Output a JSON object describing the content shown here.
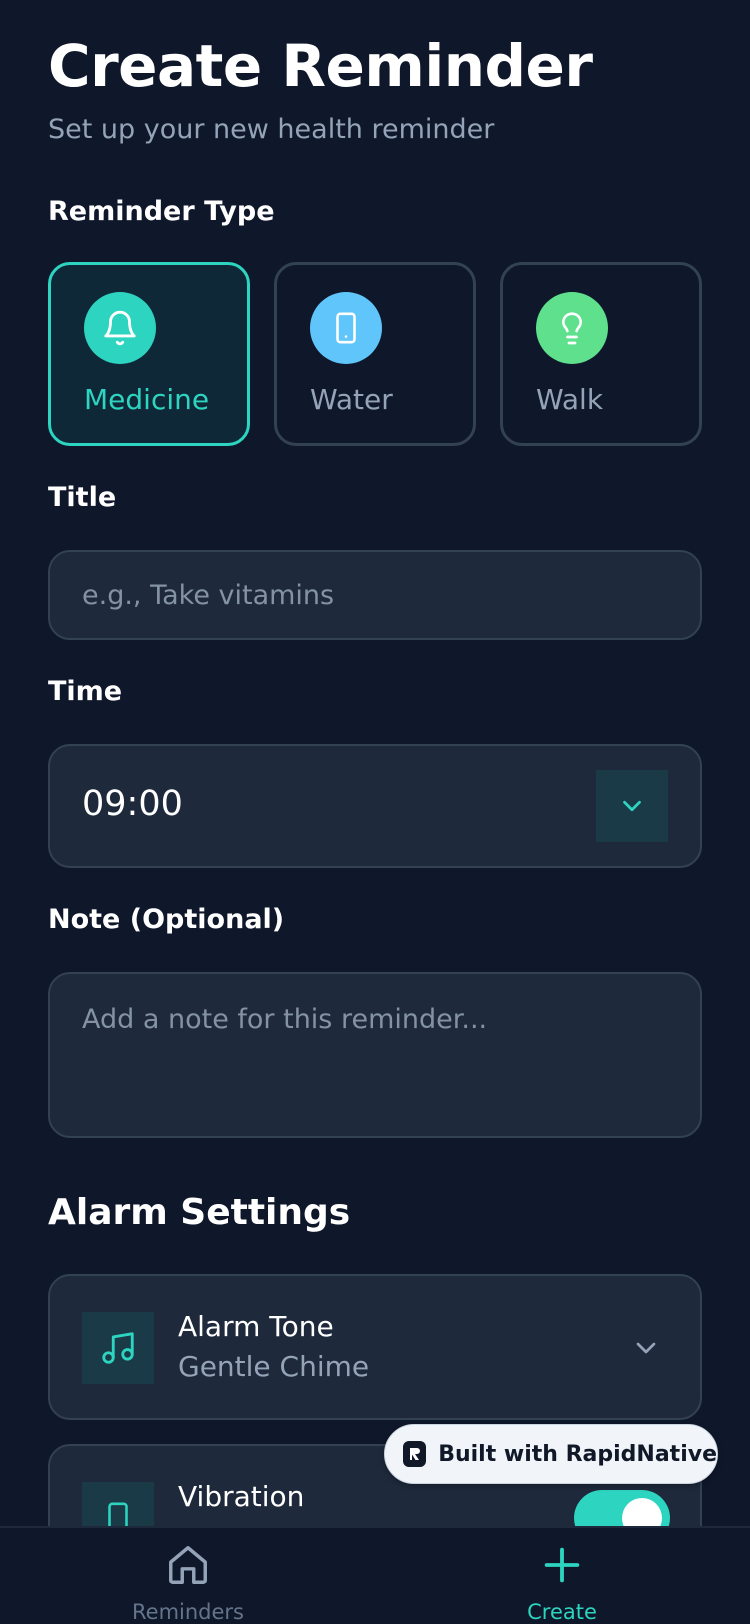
{
  "header": {
    "title": "Create Reminder",
    "subtitle": "Set up your new health reminder"
  },
  "reminder_type": {
    "label": "Reminder Type",
    "options": [
      {
        "label": "Medicine",
        "icon": "bell-icon",
        "color": "#2dd4bf",
        "selected": true
      },
      {
        "label": "Water",
        "icon": "phone-icon",
        "color": "#60c5fa",
        "selected": false
      },
      {
        "label": "Walk",
        "icon": "lightbulb-icon",
        "color": "#5fe08c",
        "selected": false
      }
    ]
  },
  "title_field": {
    "label": "Title",
    "placeholder": "e.g., Take vitamins"
  },
  "time_field": {
    "label": "Time",
    "value": "09:00"
  },
  "note_field": {
    "label": "Note (Optional)",
    "placeholder": "Add a note for this reminder..."
  },
  "alarm_settings": {
    "title": "Alarm Settings",
    "alarm_tone": {
      "title": "Alarm Tone",
      "value": "Gentle Chime",
      "icon": "music-note-icon"
    },
    "vibration": {
      "title": "Vibration",
      "icon": "phone-icon",
      "enabled": true
    }
  },
  "badge": {
    "text": "Built with RapidNative"
  },
  "bottom_nav": {
    "items": [
      {
        "label": "Reminders",
        "icon": "home-icon",
        "active": false
      },
      {
        "label": "Create",
        "icon": "plus-icon",
        "active": true
      }
    ]
  },
  "colors": {
    "background": "#0f172a",
    "surface": "#1e293b",
    "border": "#334155",
    "accent": "#2dd4bf",
    "muted_text": "#94a3b8"
  }
}
